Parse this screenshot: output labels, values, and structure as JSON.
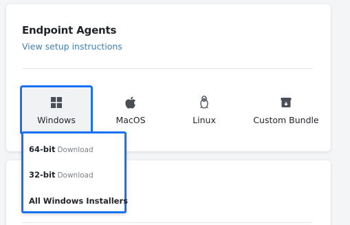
{
  "section": {
    "title": "Endpoint Agents",
    "setup_link": "View setup instructions"
  },
  "os_tabs": [
    {
      "label": "Windows",
      "icon": "windows-icon",
      "selected": true
    },
    {
      "label": "MacOS",
      "icon": "apple-icon",
      "selected": false
    },
    {
      "label": "Linux",
      "icon": "linux-icon",
      "selected": false
    },
    {
      "label": "Custom Bundle",
      "icon": "archive-icon",
      "selected": false
    }
  ],
  "dropdown": {
    "items": [
      {
        "label": "64-bit",
        "sub": "Download"
      },
      {
        "label": "32-bit",
        "sub": "Download"
      },
      {
        "label": "All Windows Installers",
        "sub": ""
      }
    ]
  },
  "colors": {
    "highlight": "#1672f3",
    "link": "#3d7fb4",
    "page_bg": "#f4f5f7"
  }
}
